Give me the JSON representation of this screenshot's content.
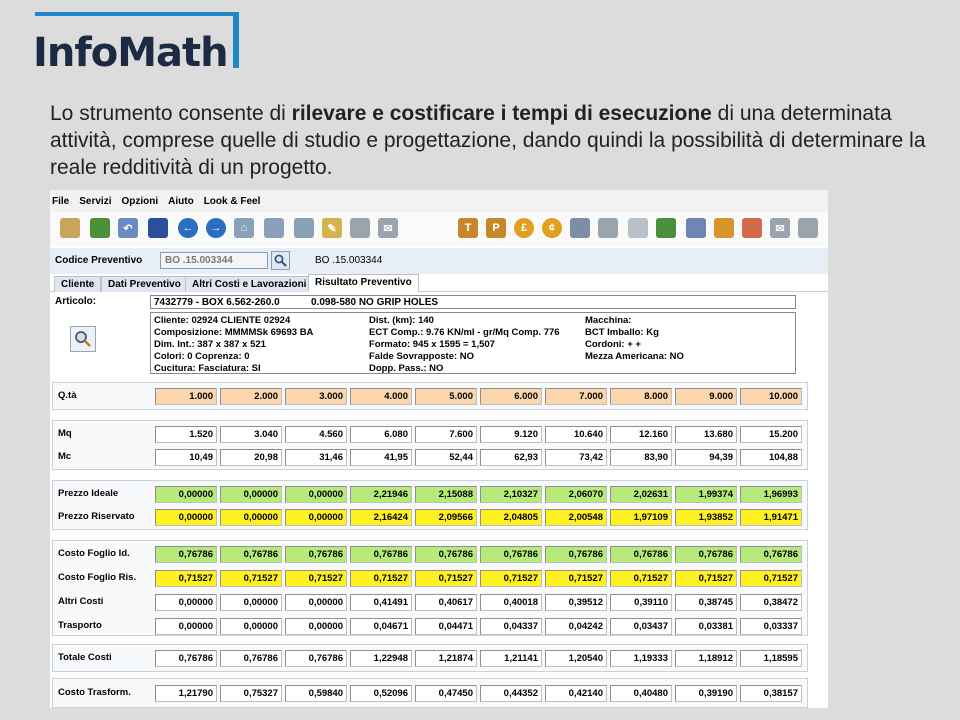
{
  "logo": {
    "text": "InfoMath",
    "accent": "#1e88c8",
    "text_color": "#1d2a44"
  },
  "description": {
    "p1": "Lo strumento consente di ",
    "bold": "rilevare e costificare i tempi di esecuzione",
    "p2": " di una determinata attività, comprese quelle di studio e progettazione, dando quindi la possibilità di determinare la reale redditività di un progetto."
  },
  "menu": [
    "File",
    "Servizi",
    "Opzioni",
    "Aiuto",
    "Look & Feel"
  ],
  "toolbar_icons": [
    {
      "name": "new-document-icon",
      "glyph": "",
      "color": "#c9a45c"
    },
    {
      "name": "import-icon",
      "glyph": "",
      "color": "#4a8f3c"
    },
    {
      "name": "undo-icon",
      "glyph": "↶",
      "color": "#6c8cc0"
    },
    {
      "name": "save-icon",
      "glyph": "",
      "color": "#2b4f9a"
    },
    {
      "name": "back-icon",
      "glyph": "←",
      "color": "#2a6ec0"
    },
    {
      "name": "forward-icon",
      "glyph": "→",
      "color": "#2a6ec0"
    },
    {
      "name": "home-icon",
      "glyph": "⌂",
      "color": "#8aa0b8"
    },
    {
      "name": "search-icon",
      "glyph": "",
      "color": "#8aa0b8"
    },
    {
      "name": "tools-icon",
      "glyph": "",
      "color": "#8aa0b8"
    },
    {
      "name": "edit-icon",
      "glyph": "✎",
      "color": "#d2b44c"
    },
    {
      "name": "print-icon",
      "glyph": "",
      "color": "#9aa4ae"
    },
    {
      "name": "mail-icon",
      "glyph": "✉",
      "color": "#9aa4ae"
    },
    {
      "name": "t-icon",
      "glyph": "T",
      "color": "#c8862a"
    },
    {
      "name": "p-icon",
      "glyph": "P",
      "color": "#c8862a"
    },
    {
      "name": "pound-icon",
      "glyph": "£",
      "color": "#e0a020"
    },
    {
      "name": "cent-icon",
      "glyph": "¢",
      "color": "#e0a020"
    },
    {
      "name": "settings-icon",
      "glyph": "",
      "color": "#7c8ea6"
    },
    {
      "name": "print2-icon",
      "glyph": "",
      "color": "#9aa4ae"
    },
    {
      "name": "pages-icon",
      "glyph": "",
      "color": "#b8c0ca"
    },
    {
      "name": "export-icon",
      "glyph": "",
      "color": "#4a8f3c"
    },
    {
      "name": "database-icon",
      "glyph": "",
      "color": "#6d86b4"
    },
    {
      "name": "report-icon",
      "glyph": "",
      "color": "#d8942a"
    },
    {
      "name": "copy-icon",
      "glyph": "",
      "color": "#d46a4a"
    },
    {
      "name": "mail2-icon",
      "glyph": "✉",
      "color": "#9aa4ae"
    },
    {
      "name": "print3-icon",
      "glyph": "",
      "color": "#9aa4ae"
    }
  ],
  "codice": {
    "label": "Codice Preventivo",
    "input_value": "BO  .15.003344",
    "display": "BO  .15.003344"
  },
  "tabs": [
    "Cliente",
    "Dati Preventivo",
    "Altri Costi e Lavorazioni",
    "Risultato Preventivo"
  ],
  "articolo": {
    "label": "Articolo:",
    "code": "7432779 - BOX 6.562-260.0",
    "desc": "0.098-580 NO GRIP HOLES"
  },
  "info": {
    "col1": [
      "Cliente:  02924 CLIENTE 02924",
      "Composizione:  MMMMSk 69693 BA",
      "Dim. Int.:  387 x 387 x 521",
      "Colori:  0     Coprenza:  0",
      "Cucitura:     Fasciatura: SI"
    ],
    "col2": [
      "Dist. (km): 140",
      "ECT Comp.:  9.76   KN/ml  - gr/Mq Comp. 776",
      "Formato:  945 x 1595 =  1,507",
      "Falde Sovrapposte:  NO",
      "Dopp. Pass.:  NO"
    ],
    "col3": [
      "Macchina:",
      "BCT Imballo:  Kg",
      "Cordoni:   +  +",
      "Mezza Americana: NO"
    ]
  },
  "grid": {
    "qta": {
      "label": "Q.tà",
      "values": [
        "1.000",
        "2.000",
        "3.000",
        "4.000",
        "5.000",
        "6.000",
        "7.000",
        "8.000",
        "9.000",
        "10.000"
      ]
    },
    "mq": {
      "label": "Mq",
      "values": [
        "1.520",
        "3.040",
        "4.560",
        "6.080",
        "7.600",
        "9.120",
        "10.640",
        "12.160",
        "13.680",
        "15.200"
      ]
    },
    "mc": {
      "label": "Mc",
      "values": [
        "10,49",
        "20,98",
        "31,46",
        "41,95",
        "52,44",
        "62,93",
        "73,42",
        "83,90",
        "94,39",
        "104,88"
      ]
    },
    "prezzo_ideale": {
      "label": "Prezzo Ideale",
      "values": [
        "0,00000",
        "0,00000",
        "0,00000",
        "2,21946",
        "2,15088",
        "2,10327",
        "2,06070",
        "2,02631",
        "1,99374",
        "1,96993"
      ]
    },
    "prezzo_riservato": {
      "label": "Prezzo Riservato",
      "values": [
        "0,00000",
        "0,00000",
        "0,00000",
        "2,16424",
        "2,09566",
        "2,04805",
        "2,00548",
        "1,97109",
        "1,93852",
        "1,91471"
      ]
    },
    "costo_foglio_id": {
      "label": "Costo Foglio Id.",
      "values": [
        "0,76786",
        "0,76786",
        "0,76786",
        "0,76786",
        "0,76786",
        "0,76786",
        "0,76786",
        "0,76786",
        "0,76786",
        "0,76786"
      ]
    },
    "costo_foglio_ris": {
      "label": "Costo Foglio Ris.",
      "values": [
        "0,71527",
        "0,71527",
        "0,71527",
        "0,71527",
        "0,71527",
        "0,71527",
        "0,71527",
        "0,71527",
        "0,71527",
        "0,71527"
      ]
    },
    "altri_costi": {
      "label": "Altri Costi",
      "values": [
        "0,00000",
        "0,00000",
        "0,00000",
        "0,41491",
        "0,40617",
        "0,40018",
        "0,39512",
        "0,39110",
        "0,38745",
        "0,38472"
      ]
    },
    "trasporto": {
      "label": "Trasporto",
      "values": [
        "0,00000",
        "0,00000",
        "0,00000",
        "0,04671",
        "0,04471",
        "0,04337",
        "0,04242",
        "0,03437",
        "0,03381",
        "0,03337"
      ]
    },
    "totale_costi": {
      "label": "Totale Costi",
      "values": [
        "0,76786",
        "0,76786",
        "0,76786",
        "1,22948",
        "1,21874",
        "1,21141",
        "1,20540",
        "1,19333",
        "1,18912",
        "1,18595"
      ]
    },
    "costo_trasform": {
      "label": "Costo Trasform.",
      "values": [
        "1,21790",
        "0,75327",
        "0,59840",
        "0,52096",
        "0,47450",
        "0,44352",
        "0,42140",
        "0,40480",
        "0,39190",
        "0,38157"
      ]
    }
  },
  "colors": {
    "peach": "#fbd6ac",
    "green": "#b6ea7b",
    "yellow": "#fff021"
  }
}
